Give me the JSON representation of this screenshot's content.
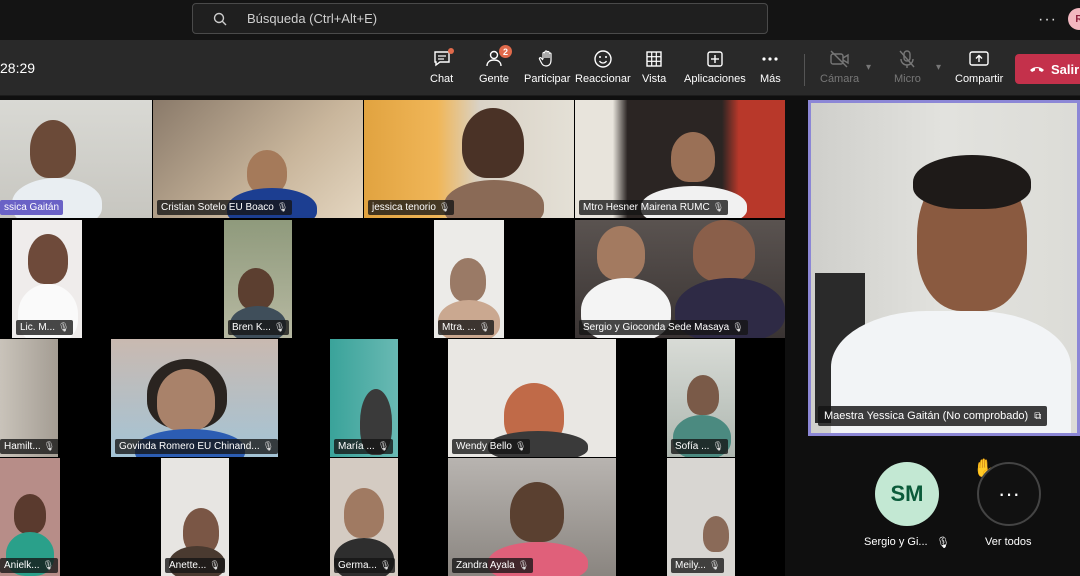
{
  "search": {
    "placeholder": "Búsqueda (Ctrl+Alt+E)"
  },
  "topbar": {
    "more": "···",
    "avatar_initial": "R"
  },
  "meeting": {
    "timer": "28:29"
  },
  "toolbar": {
    "chat": "Chat",
    "people": "Gente",
    "people_count": "2",
    "participate": "Participar",
    "react": "Reaccionar",
    "view": "Vista",
    "apps": "Aplicaciones",
    "more": "Más",
    "camera": "Cámara",
    "mic": "Micro",
    "share": "Compartir",
    "leave": "Salir"
  },
  "participants": [
    {
      "name": "Maestra Yessica Gaitán",
      "short": "ssica Gaitán"
    },
    {
      "name": "Cristian Sotelo EU Boaco"
    },
    {
      "name": "jessica tenorio"
    },
    {
      "name": "Mtro Hesner Mairena RUMC"
    },
    {
      "name": "Lic. M..."
    },
    {
      "name": "Bren K..."
    },
    {
      "name": "Mtra. ..."
    },
    {
      "name": "Sergio y Gioconda Sede Masaya"
    },
    {
      "name": "Hamilt..."
    },
    {
      "name": "Govinda Romero EU Chinand..."
    },
    {
      "name": "María ..."
    },
    {
      "name": "Wendy Bello"
    },
    {
      "name": "Sofía ..."
    },
    {
      "name": "Anielk..."
    },
    {
      "name": "Anette..."
    },
    {
      "name": "Germa..."
    },
    {
      "name": "Zandra Ayala"
    },
    {
      "name": "Meily..."
    }
  ],
  "spotlight": {
    "name": "Maestra Yessica Gaitán (No comprobado)"
  },
  "bottom": {
    "sm_initials": "SM",
    "sm_label": "Sergio y Gi...",
    "more_label": "Ver todos",
    "more_glyph": "···",
    "hand": "✋"
  },
  "colors": {
    "accent": "#8c87d6",
    "leave": "#c4314b",
    "badge": "#e06a4b"
  }
}
